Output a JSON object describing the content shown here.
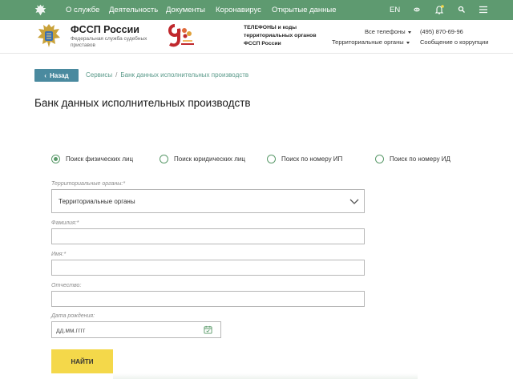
{
  "topnav": {
    "items": [
      "О службе",
      "Деятельность",
      "Документы",
      "Коронавирус",
      "Открытые данные"
    ],
    "lang": "EN",
    "icons": [
      "emblem-icon",
      "accessibility-icon",
      "bell-icon",
      "search-icon",
      "menu-icon"
    ]
  },
  "header": {
    "brand": "ФССП России",
    "brand_sub": "Федеральная служба судебных приставов",
    "phones_title": "ТЕЛЕФОНЫ и коды территориальных органов ФССП России",
    "all_phones": "Все телефоны",
    "territorial": "Территориальные органы",
    "phone": "(495) 870-69-96",
    "corruption": "Сообщение о коррупции"
  },
  "breadcrumb": {
    "back": "Назад",
    "items": [
      "Сервисы",
      "Банк данных исполнительных производств"
    ]
  },
  "page": {
    "title": "Банк данных исполнительных производств"
  },
  "search_modes": [
    {
      "label": "Поиск физических лиц",
      "selected": true
    },
    {
      "label": "Поиск юридических лиц",
      "selected": false
    },
    {
      "label": "Поиск по номеру ИП",
      "selected": false
    },
    {
      "label": "Поиск по номеру ИД",
      "selected": false
    }
  ],
  "form": {
    "territorial_label": "Территориальные органы:*",
    "territorial_value": "Территориальные органы",
    "lastname_label": "Фамилия:*",
    "lastname_value": "",
    "firstname_label": "Имя:*",
    "firstname_value": "",
    "patronymic_label": "Отчество:",
    "patronymic_value": "",
    "birthdate_label": "Дата рождения:",
    "birthdate_placeholder": "дд.мм.гггг",
    "submit": "НАЙТИ"
  },
  "colors": {
    "green": "#5e9a70",
    "teal": "#4a8a9f",
    "yellow": "#f4d84a"
  }
}
